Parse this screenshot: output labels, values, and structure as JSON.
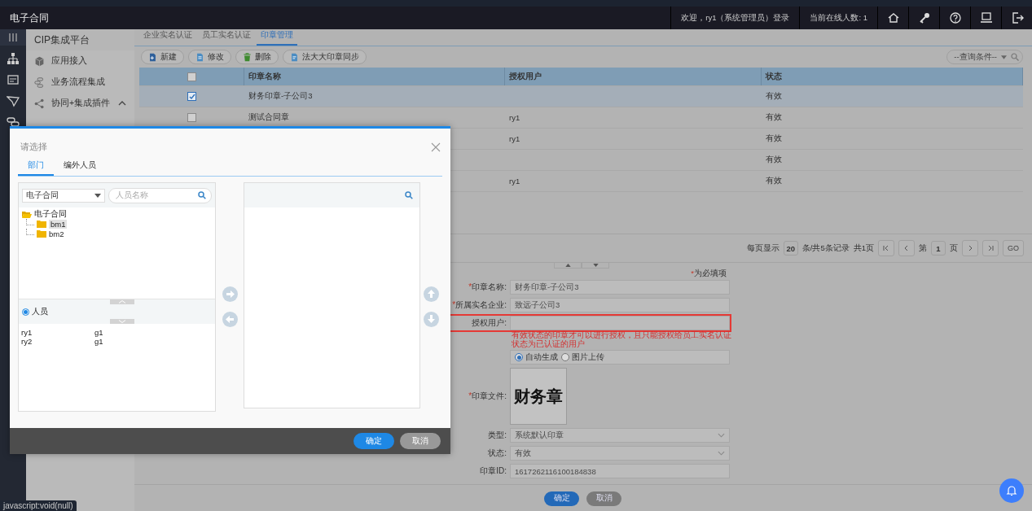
{
  "header": {
    "title": "电子合同",
    "welcome": "欢迎，ry1（系统管理员）登录",
    "online": "当前在线人数: 1"
  },
  "sidebar": {
    "title": "CIP集成平台",
    "items": [
      {
        "label": "应用接入",
        "kind": "link"
      },
      {
        "label": "业务流程集成",
        "kind": "link"
      },
      {
        "label": "协同+集成插件",
        "kind": "group",
        "expanded": true
      }
    ]
  },
  "tabs": [
    {
      "label": "企业实名认证",
      "selected": false
    },
    {
      "label": "员工实名认证",
      "selected": false
    },
    {
      "label": "印章管理",
      "selected": true
    }
  ],
  "toolbar": [
    "新建",
    "修改",
    "删除",
    "法大大印章同步"
  ],
  "query": {
    "value": "--查询条件--"
  },
  "table": {
    "header_checked": false,
    "columns": [
      "印章名称",
      "授权用户",
      "状态"
    ],
    "rows": [
      {
        "selected": true,
        "checked": true,
        "name": "财务印章-子公司3",
        "status": "有效"
      },
      {
        "selected": false,
        "checked": false,
        "name": "测试合同章",
        "user": "ry1",
        "status": "有效"
      },
      {
        "selected": false,
        "user": "ry1",
        "status": "有效"
      },
      {
        "selected": false,
        "status": "有效"
      },
      {
        "selected": false,
        "user": "ry1",
        "status": "有效"
      }
    ]
  },
  "pager": {
    "per_page_label": "每页显示",
    "per_page": "20",
    "records": "条/共5条记录",
    "pages": "共1页",
    "page_prefix": "第",
    "page": "1",
    "page_suffix": "页",
    "go": "GO"
  },
  "form": {
    "required_mark": "*",
    "required_note": "为必填项",
    "fields": [
      {
        "kind": "text",
        "label": "印章名称:",
        "required": true,
        "highlighted": false,
        "value": "财务印章-子公司3"
      },
      {
        "kind": "text",
        "label": "所属实名企业:",
        "required": true,
        "highlighted": false,
        "value": "致远子公司3"
      },
      {
        "kind": "text",
        "label": "授权用户:",
        "required": false,
        "highlighted": true
      },
      {
        "kind": "hint",
        "text": "有效状态的印章才可以进行授权，且只能授权给员工实名认证状态为已认证的用户"
      },
      {
        "kind": "radio",
        "options": [
          {
            "label": "自动生成",
            "selected": true
          },
          {
            "label": "图片上传",
            "selected": false
          }
        ]
      },
      {
        "kind": "image",
        "label": "印章文件:",
        "required": true,
        "stamp": "财务章"
      },
      {
        "kind": "select",
        "label": "类型:",
        "required": false,
        "value": "系统默认印章"
      },
      {
        "kind": "select",
        "label": "状态:",
        "required": false,
        "value": "有效"
      },
      {
        "kind": "text",
        "label": "印章ID:",
        "required": false,
        "highlighted": false,
        "value": "1617262116100184838"
      }
    ],
    "buttons": [
      {
        "label": "确定",
        "kind": "primary"
      },
      {
        "label": "取消",
        "kind": "secondary"
      }
    ]
  },
  "dialog": {
    "title": "请选择",
    "tabs": [
      {
        "label": "部门",
        "selected": true
      },
      {
        "label": "编外人员",
        "selected": false
      }
    ],
    "org_select": {
      "value": "电子合同"
    },
    "person_search": {
      "placeholder": "人员名称"
    },
    "tree": [
      {
        "label": "电子合同",
        "expanded": true,
        "selected": false,
        "children": [
          {
            "label": "bm1",
            "selected": true
          },
          {
            "label": "bm2",
            "selected": false
          }
        ]
      }
    ],
    "people_option": {
      "label": "人员",
      "checked": true
    },
    "people": [
      {
        "name": "ry1",
        "group": "g1"
      },
      {
        "name": "ry2",
        "group": "g1"
      }
    ],
    "buttons": [
      {
        "label": "确定",
        "kind": "primary"
      },
      {
        "label": "取消",
        "kind": "secondary"
      }
    ]
  },
  "status_tooltip": "javascript:void(null)"
}
